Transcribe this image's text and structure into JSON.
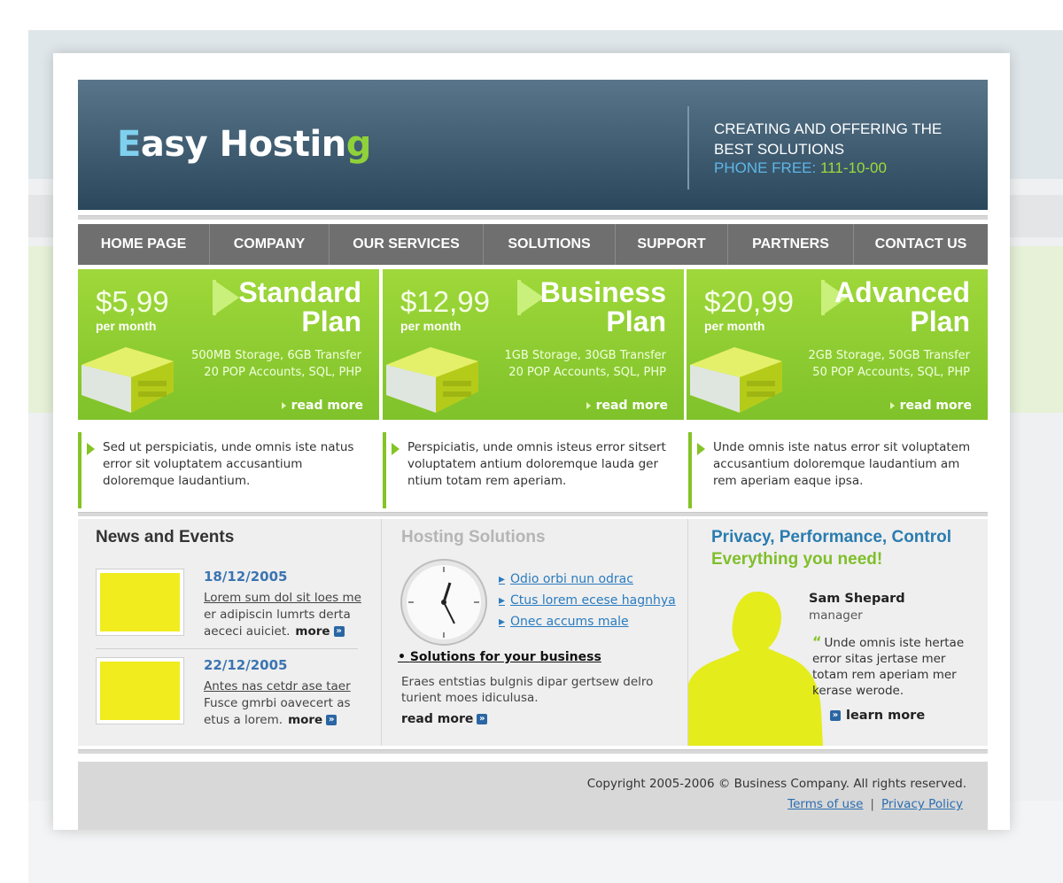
{
  "logo": {
    "e": "E",
    "mid": "asy Hostin",
    "g": "g"
  },
  "header": {
    "tagline": "CREATING AND OFFERING THE BEST SOLUTIONS",
    "phone_label": "PHONE FREE:",
    "phone_number": "111-10-00"
  },
  "nav": [
    "HOME PAGE",
    "COMPANY",
    "OUR SERVICES",
    "SOLUTIONS",
    "SUPPORT",
    "PARTNERS",
    "CONTACT US"
  ],
  "plans": [
    {
      "price": "$5,99",
      "per": "per month",
      "title1": "Standard",
      "title2": "Plan",
      "feat1": "500MB Storage, 6GB Transfer",
      "feat2": "20 POP Accounts, SQL, PHP",
      "read_more": "read more"
    },
    {
      "price": "$12,99",
      "per": "per month",
      "title1": "Business",
      "title2": "Plan",
      "feat1": "1GB Storage, 30GB Transfer",
      "feat2": "20 POP Accounts, SQL, PHP",
      "read_more": "read more"
    },
    {
      "price": "$20,99",
      "per": "per month",
      "title1": "Advanced",
      "title2": "Plan",
      "feat1": "2GB Storage, 50GB Transfer",
      "feat2": "50 POP Accounts, SQL, PHP",
      "read_more": "read more"
    }
  ],
  "descriptions": [
    "Sed ut perspiciatis, unde omnis iste natus error sit voluptatem accusantium doloremque laudantium.",
    "Perspiciatis, unde omnis isteus error sitsert voluptatem antium doloremque lauda ger ntium totam rem aperiam.",
    "Unde omnis iste natus error sit voluptatem accusantium doloremque laudantium am rem aperiam eaque ipsa."
  ],
  "news": {
    "title": "News and Events",
    "items": [
      {
        "date": "18/12/2005",
        "link": "Lorem sum dol sit loes me",
        "text": "er adipiscin lumrts derta aececi auiciet.",
        "more": "more"
      },
      {
        "date": "22/12/2005",
        "link": "Antes nas cetdr ase taer",
        "text": "Fusce gmrbi oavecert as etus a lorem.",
        "more": "more"
      }
    ]
  },
  "hosting": {
    "title": "Hosting Solutions",
    "links": [
      "Odio orbi nun odrac",
      "Ctus lorem ecese hagnhya",
      "Onec accums male"
    ],
    "heading": "Solutions for your business",
    "text": "Eraes entstias bulgnis dipar gertsew delro turient moes idiculusa.",
    "read_more": "read more"
  },
  "privacy": {
    "title1": "Privacy, Performance, Control",
    "title2": "Everything you need!",
    "name": "Sam Shepard",
    "role": "manager",
    "quote": "Unde omnis iste hertae error sitas jertase mer totam rem aperiam mer kerase werode.",
    "learn_more": "learn more"
  },
  "footer": {
    "copyright": "Copyright 2005-2006 © Business Company. All rights reserved.",
    "terms": "Terms of use",
    "sep": "|",
    "privacy": "Privacy Policy"
  },
  "colors": {
    "header_top": "#58758a",
    "header_bottom": "#2b475c",
    "nav": "#6f6f6f",
    "green": "#8fd13a",
    "link": "#2a7cc0",
    "accent_yellow": "#f1ec1e"
  }
}
